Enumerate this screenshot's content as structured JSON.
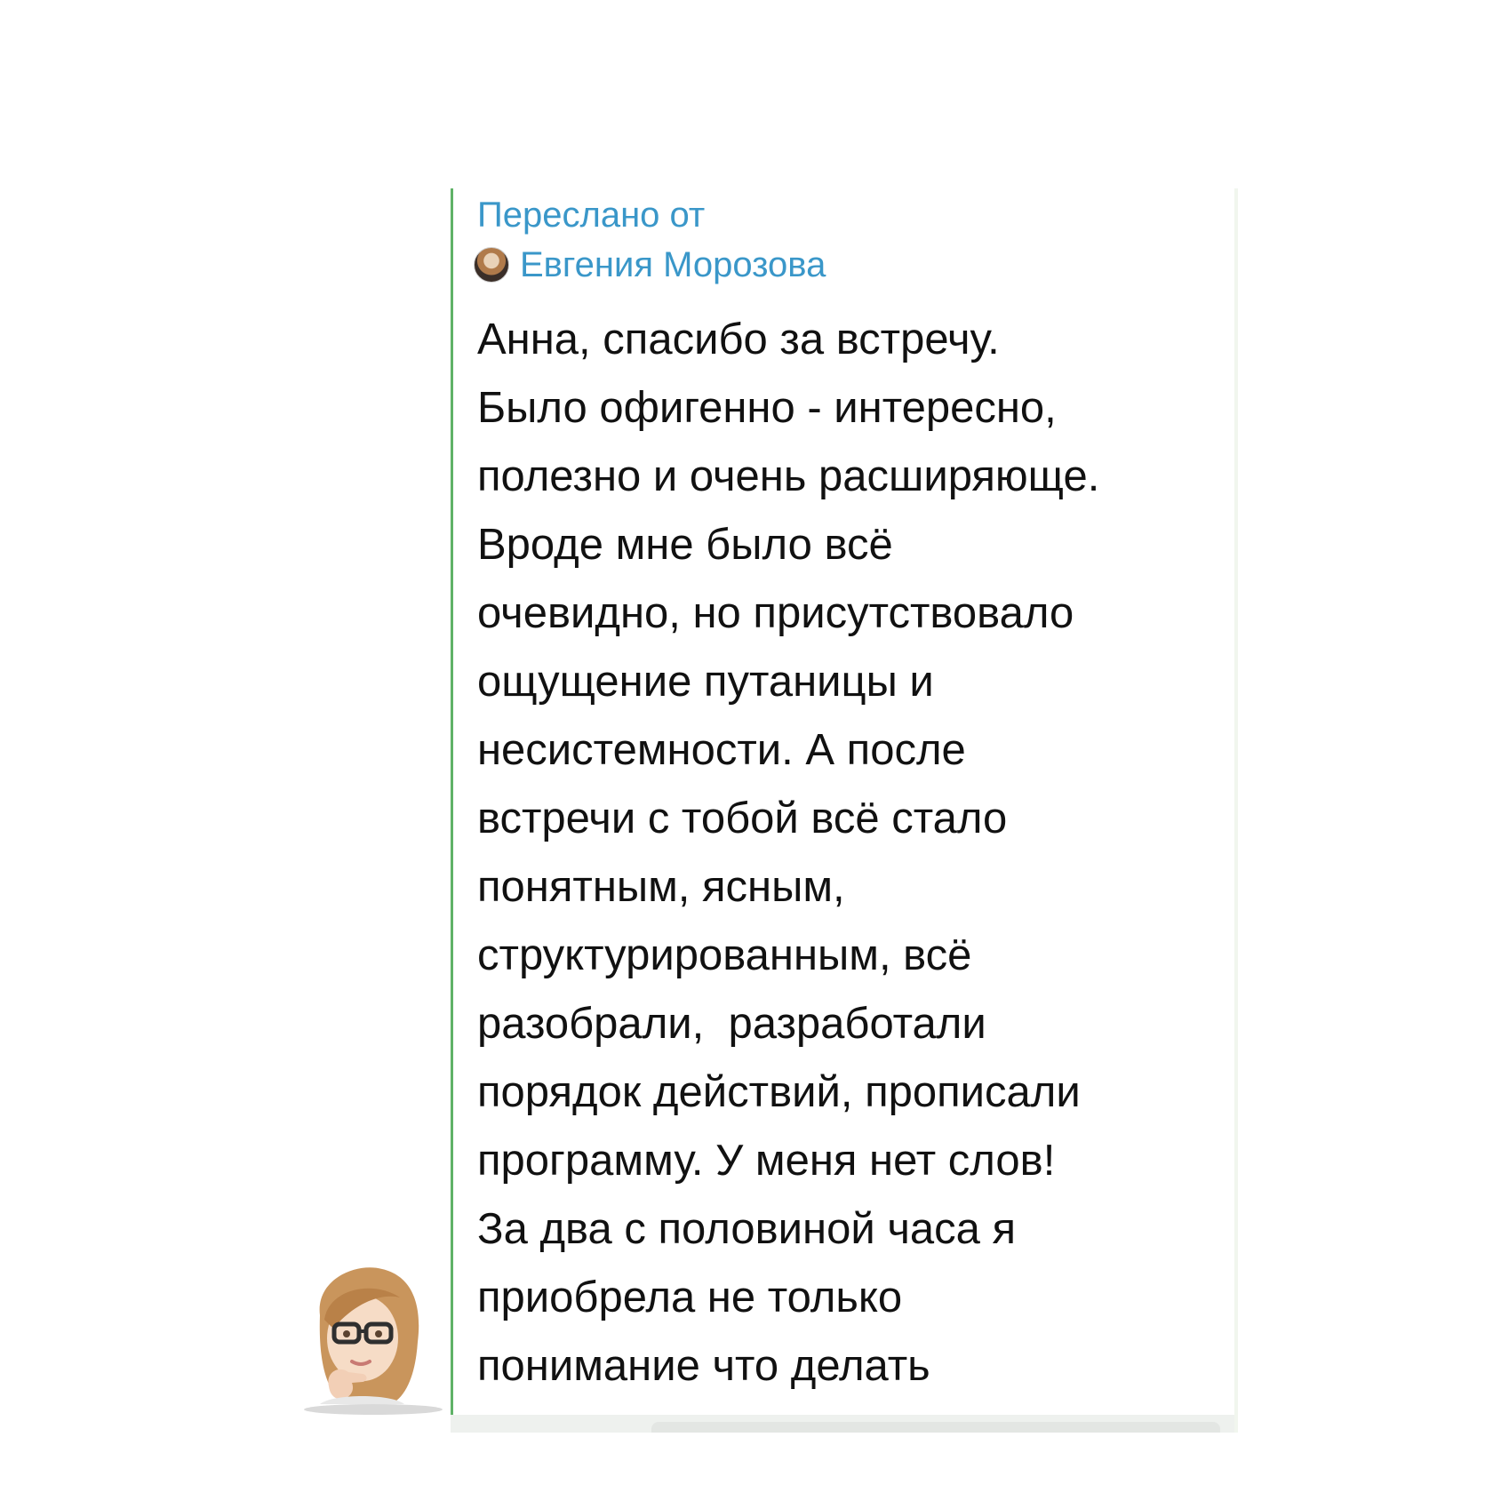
{
  "forwarded": {
    "label": "Переслано от",
    "sender_name": "Евгения Морозова"
  },
  "message": {
    "lines": [
      "Анна, спасибо за встречу.",
      "Было офигенно - интересно,",
      "полезно и очень расширяюще.",
      "Вроде мне было всё",
      "очевидно, но присутствовало",
      "ощущение путаницы и",
      "несистемности. А после",
      "встречи с тобой всё стало",
      "понятным, ясным,",
      "структурированным, всё",
      "разобрали,  разработали",
      "порядок действий, прописали",
      "программу. У меня нет слов!",
      "За два с половиной часа я",
      "приобрела не только",
      "понимание что делать"
    ]
  },
  "colors": {
    "accent": "#3a97c9",
    "forward_bar": "#5fb267",
    "text": "#111111",
    "background": "#ffffff"
  }
}
